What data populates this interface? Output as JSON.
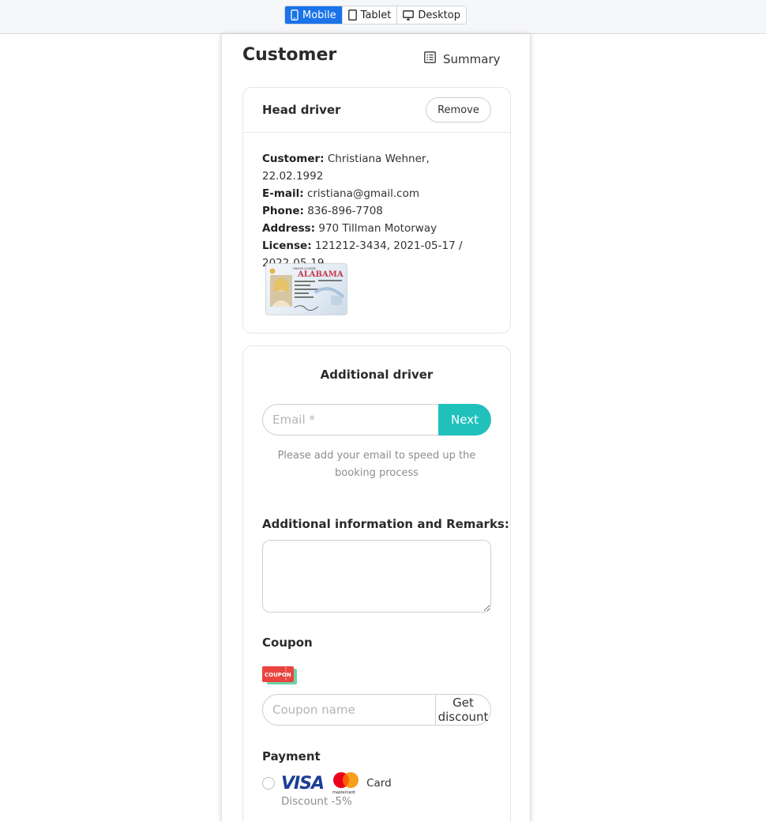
{
  "toolbar": {
    "devices": [
      {
        "label": "Mobile",
        "icon": "phone-icon",
        "active": true
      },
      {
        "label": "Tablet",
        "icon": "tablet-icon",
        "active": false
      },
      {
        "label": "Desktop",
        "icon": "monitor-icon",
        "active": false
      }
    ],
    "accent": "#1a73e8"
  },
  "page": {
    "title": "Customer",
    "summary_label": "Summary",
    "summary_icon": "list-icon"
  },
  "head_driver": {
    "title": "Head driver",
    "remove_label": "Remove",
    "fields": [
      {
        "label": "Customer:",
        "value": "Christiana Wehner, 22.02.1992"
      },
      {
        "label": "E-mail:",
        "value": "cristiana@gmail.com"
      },
      {
        "label": "Phone:",
        "value": "836-896-7708"
      },
      {
        "label": "Address:",
        "value": "970 Tillman Motorway"
      },
      {
        "label": "License:",
        "value": "121212-3434, 2021-05-17 / 2022-05-19"
      }
    ],
    "license_image": {
      "state_text": "ALABAMA",
      "caption": "DRIVER LICENSE"
    }
  },
  "additional_driver": {
    "title": "Additional driver",
    "email_placeholder": "Email *",
    "next_label": "Next",
    "hint": "Please add your email to speed up the booking process",
    "button_color": "#21c1bb"
  },
  "remarks": {
    "label": "Additional information and Remarks:",
    "value": ""
  },
  "coupon": {
    "label": "Coupon",
    "icon_text": "COUPON",
    "placeholder": "Coupon name",
    "button_label": "Get discount"
  },
  "payment": {
    "label": "Payment",
    "visa_text": "VISA",
    "mastercard_text": "mastercard",
    "card_label": "Card",
    "discount": "Discount -5%"
  }
}
